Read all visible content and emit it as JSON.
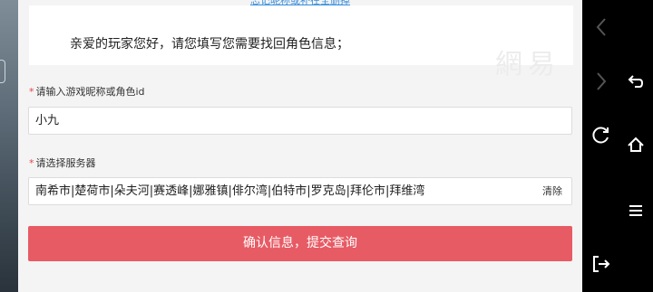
{
  "page": {
    "top_link": "忘记昵称或补在全删掉",
    "notice": "亲爱的玩家您好，请您填写您需要找回角色信息；",
    "watermark": "網易"
  },
  "form": {
    "required_mark": "*",
    "nickname": {
      "label": "请输入游戏昵称或角色id",
      "value": "小九"
    },
    "server": {
      "label": "请选择服务器",
      "value": "南希市|楚荷市|朵夫河|赛透峰|娜雅镇|俳尔湾|伯特市|罗克岛|拜伦市|拜维湾",
      "clear_label": "清除"
    },
    "submit_label": "确认信息，提交查询",
    "accent_color": "#e75b64"
  },
  "nav_bar": {
    "icons": [
      "back-arrow-icon",
      "return-icon",
      "refresh-icon",
      "home-icon",
      "menu-icon",
      "exit-icon"
    ]
  }
}
